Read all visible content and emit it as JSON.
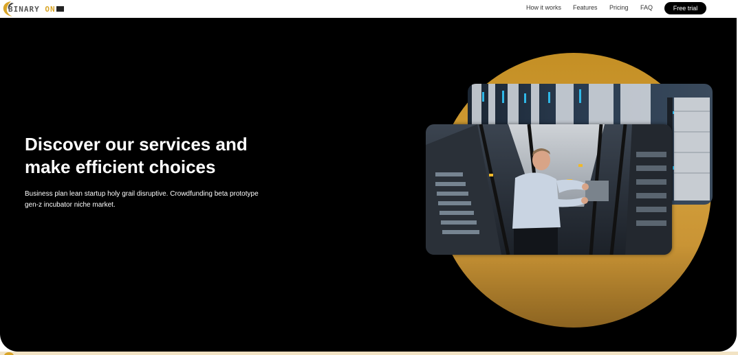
{
  "brand": {
    "logo_left": "BINARY",
    "logo_right": "ON",
    "accent_color": "#d9a528"
  },
  "nav": {
    "links": [
      {
        "label": "How it works"
      },
      {
        "label": "Features"
      },
      {
        "label": "Pricing"
      },
      {
        "label": "FAQ"
      }
    ],
    "cta_label": "Free trial"
  },
  "hero": {
    "title_line1": "Discover our services and",
    "title_line2": "make efficient choices",
    "subtitle_line1": "Business plan lean startup holy grail disruptive. Crowdfunding beta prototype",
    "subtitle_line2": "gen-z incubator niche market."
  },
  "icons": {
    "logo_swoosh": "swoosh-icon"
  }
}
